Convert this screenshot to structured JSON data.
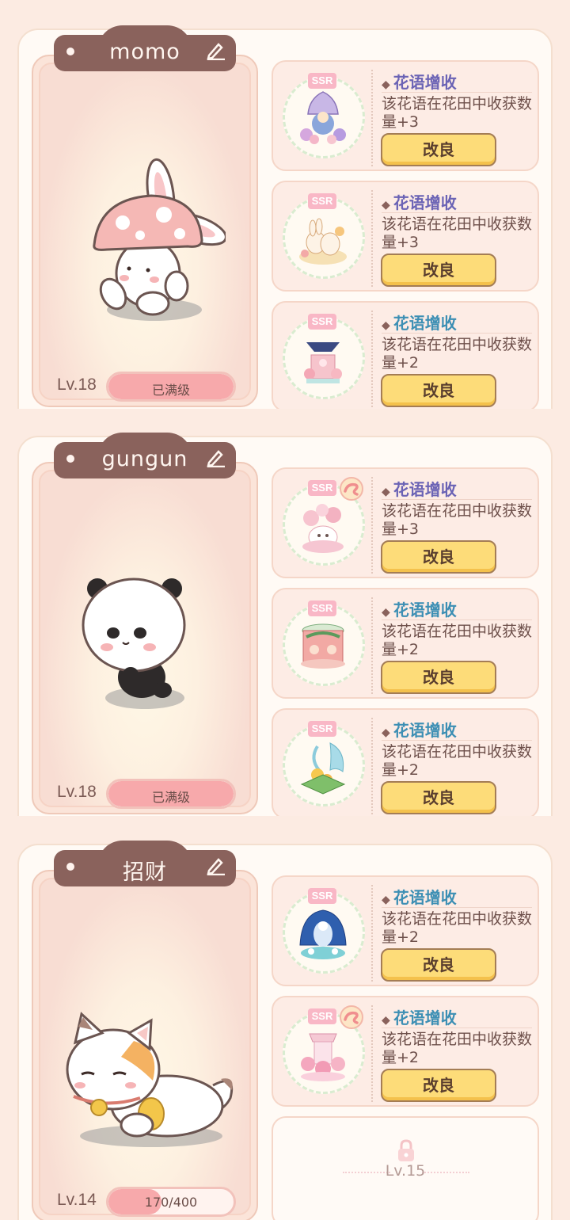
{
  "sections": [
    {
      "pet_name": "momo",
      "level": "Lv.18",
      "progress_label": "已满级",
      "progress_fraction": 1.0,
      "slots": [
        {
          "ssr": "SSR",
          "title": "花语增收",
          "title_color": "#6b63b5",
          "desc": "该花语在花田中收获数量+3",
          "button": "改良",
          "swirl": false
        },
        {
          "ssr": "SSR",
          "title": "花语增收",
          "title_color": "#6b63b5",
          "desc": "该花语在花田中收获数量+3",
          "button": "改良",
          "swirl": false
        },
        {
          "ssr": "SSR",
          "title": "花语增收",
          "title_color": "#3d8fb4",
          "desc": "该花语在花田中收获数量+2",
          "button": "改良",
          "swirl": false
        }
      ]
    },
    {
      "pet_name": "gungun",
      "level": "Lv.18",
      "progress_label": "已满级",
      "progress_fraction": 1.0,
      "slots": [
        {
          "ssr": "SSR",
          "title": "花语增收",
          "title_color": "#6b63b5",
          "desc": "该花语在花田中收获数量+3",
          "button": "改良",
          "swirl": true
        },
        {
          "ssr": "SSR",
          "title": "花语增收",
          "title_color": "#3d8fb4",
          "desc": "该花语在花田中收获数量+2",
          "button": "改良",
          "swirl": false
        },
        {
          "ssr": "SSR",
          "title": "花语增收",
          "title_color": "#3d8fb4",
          "desc": "该花语在花田中收获数量+2",
          "button": "改良",
          "swirl": false
        }
      ]
    },
    {
      "pet_name": "招财",
      "level": "Lv.14",
      "progress_label": "170/400",
      "progress_fraction": 0.425,
      "slots": [
        {
          "ssr": "SSR",
          "title": "花语增收",
          "title_color": "#3d8fb4",
          "desc": "该花语在花田中收获数量+2",
          "button": "改良",
          "swirl": false
        },
        {
          "ssr": "SSR",
          "title": "花语增收",
          "title_color": "#3d8fb4",
          "desc": "该花语在花田中收获数量+2",
          "button": "改良",
          "swirl": true
        }
      ],
      "locked_slot": {
        "level": "Lv.15"
      }
    }
  ]
}
